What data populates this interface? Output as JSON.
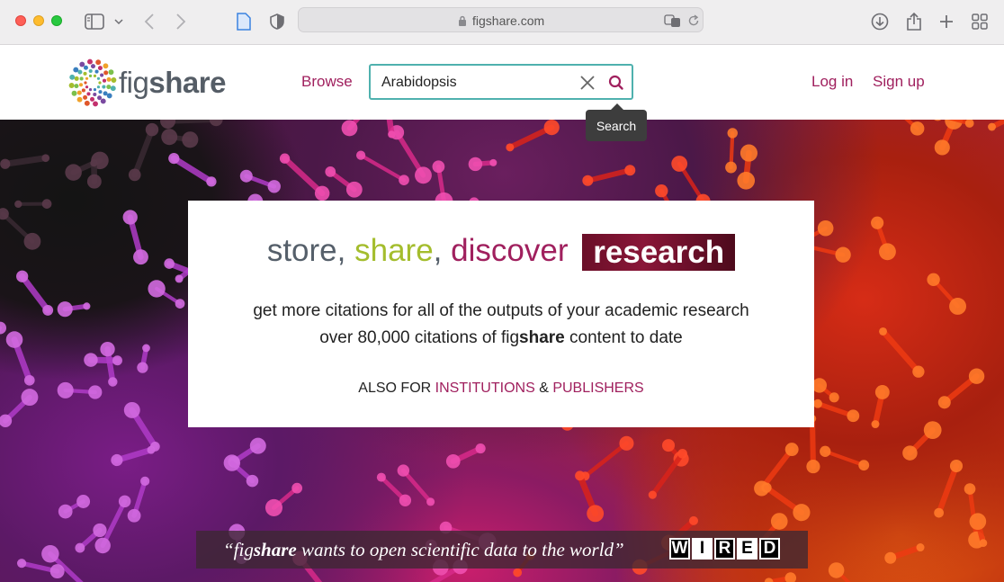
{
  "browser": {
    "url": "figshare.com"
  },
  "header": {
    "logo_fig": "fig",
    "logo_share": "share",
    "browse": "Browse",
    "search_value": "Arabidopsis",
    "login": "Log in",
    "signup": "Sign up",
    "tooltip": "Search"
  },
  "hero": {
    "tagline": {
      "store": "store,",
      "share": "share",
      "comma": ",",
      "discover": "discover",
      "research": "research"
    },
    "subtitle1": "get more citations for all of the outputs of your academic research",
    "subtitle2_pre": "over 80,000 citations of fig",
    "subtitle2_bold": "share",
    "subtitle2_post": " content to date",
    "also_for": "ALSO FOR",
    "institutions": "INSTITUTIONS",
    "amp": "&",
    "publishers": "PUBLISHERS",
    "quote_open": "“fig",
    "quote_bold": "share",
    "quote_rest": " wants to open scientific data to the world”",
    "wired_letters": [
      "W",
      "I",
      "R",
      "E",
      "D"
    ]
  },
  "colors": {
    "brand": "#a0205e",
    "search_border": "#4fb1ae",
    "share_green": "#a4bd2d",
    "slate": "#555f6a"
  }
}
